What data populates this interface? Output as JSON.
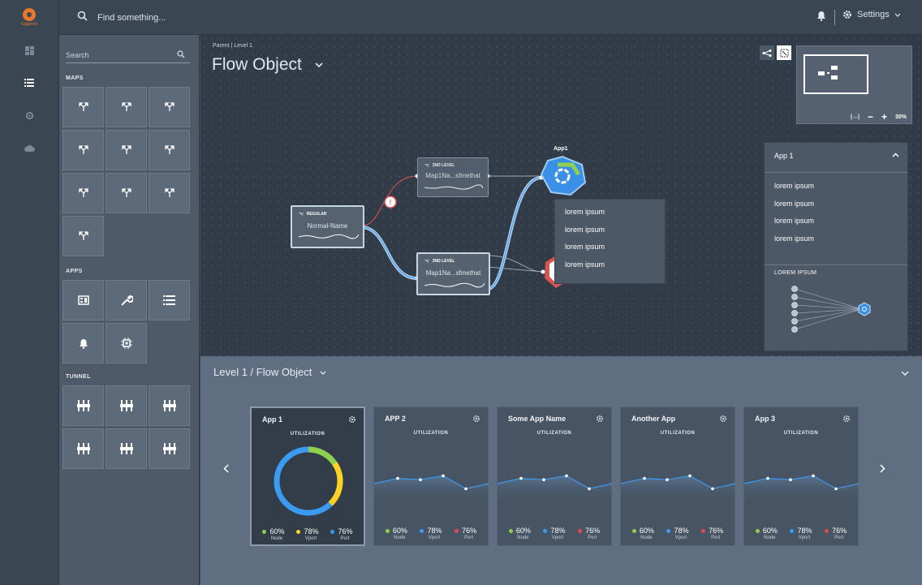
{
  "brand": {
    "name": "Gigamon",
    "accent": "#e8762d"
  },
  "rail": {
    "icons": [
      "dashboard-icon",
      "list-icon",
      "gear-icon",
      "cloud-icon"
    ]
  },
  "topbar": {
    "search_placeholder": "Find something...",
    "settings_label": "Settings"
  },
  "palette": {
    "search_label": "Search",
    "sections": {
      "maps": "MAPS",
      "apps": "APPS",
      "tunnel": "TUNNEL"
    }
  },
  "canvas": {
    "breadcrumb": "Parent | Level 1",
    "title": "Flow Object",
    "minimap_zoom": "30%",
    "nodes": {
      "regular": {
        "type": "REGULAR",
        "name": "Normal-Name"
      },
      "level2_top": {
        "type": "2ND LEVEL",
        "name": "Map1Na...sfmethat"
      },
      "level2_bottom": {
        "type": "2ND LEVEL",
        "name": "Map1Na...sfmethat"
      },
      "app": {
        "name": "App1"
      }
    },
    "context_menu": [
      "lorem ipsum",
      "lorem ipsum",
      "lorem ipsum",
      "lorem ipsum"
    ],
    "info_panel": {
      "title": "App 1",
      "items": [
        "lorem ipsum",
        "lorem ipsum",
        "lorem ipsum",
        "lorem ipsum"
      ],
      "subtitle": "LOREM IPSUM"
    }
  },
  "bottom": {
    "title": "Level 1 / Flow Object",
    "util_label": "UTILIZATION",
    "cards": [
      {
        "title": "App 1",
        "kind": "donut"
      },
      {
        "title": "APP 2",
        "kind": "line"
      },
      {
        "title": "Some App Name",
        "kind": "line"
      },
      {
        "title": "Another App",
        "kind": "line"
      },
      {
        "title": "App 3",
        "kind": "line"
      }
    ],
    "legend": [
      {
        "value": "60%",
        "label": "Node",
        "color": "#8fd14f"
      },
      {
        "value": "78%",
        "label": "Vport",
        "color": "#3a9bf0"
      },
      {
        "value": "76%",
        "label": "Port",
        "color": "#e14b4b"
      }
    ],
    "donut_legend_colors": [
      "#8fd14f",
      "#ffd21f",
      "#3a9bf0"
    ]
  },
  "chart_data": {
    "type": "area",
    "series": [
      {
        "values": [
          30,
          38,
          36,
          42,
          22,
          30
        ]
      }
    ],
    "ylim": [
      0,
      60
    ]
  }
}
